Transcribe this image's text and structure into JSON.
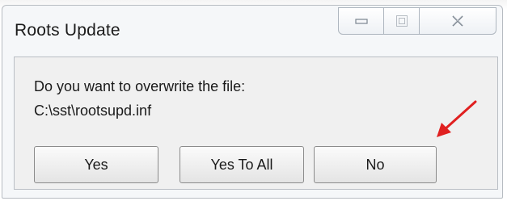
{
  "window": {
    "title": "Roots Update",
    "caption_buttons": {
      "minimize_icon": "minimize-icon",
      "maximize_icon": "maximize-icon",
      "close_icon": "close-icon"
    }
  },
  "dialog": {
    "message_line1": "Do you want to overwrite the file:",
    "message_line2": "C:\\sst\\rootsupd.inf",
    "buttons": {
      "yes": "Yes",
      "yes_to_all": "Yes To All",
      "no": "No"
    }
  },
  "annotation": {
    "arrow_color": "#e02020",
    "icon": "arrow-icon"
  }
}
